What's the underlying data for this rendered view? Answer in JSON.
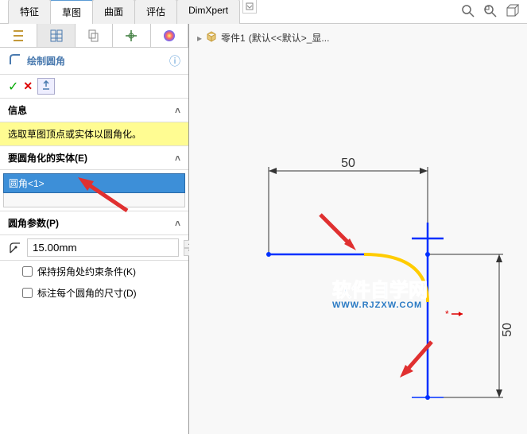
{
  "tabs": {
    "features": "特征",
    "sketch": "草图",
    "surface": "曲面",
    "evaluate": "评估",
    "dimxpert": "DimXpert"
  },
  "breadcrumb": {
    "part": "零件1",
    "config": "(默认<<默认>_显..."
  },
  "panel": {
    "title": "绘制圆角",
    "info_header": "信息",
    "info_text": "选取草图顶点或实体以圆角化。",
    "entities_header": "要圆角化的实体(E)",
    "entity_item": "圆角<1>",
    "params_header": "圆角参数(P)",
    "radius_value": "15.00mm",
    "keep_constraints": "保持拐角处约束条件(K)",
    "label_dims": "标注每个圆角的尺寸(D)"
  },
  "sketch_dims": {
    "horizontal": "50",
    "vertical": "50"
  },
  "watermark": {
    "cn": "软件自学网",
    "url": "WWW.RJZXW.COM"
  },
  "chart_data": {
    "type": "diagram",
    "description": "2D sketch with two perpendicular line segments meeting at a corner being filleted",
    "horizontal_line_length": 50,
    "vertical_line_length": 50,
    "fillet_radius": 15.0,
    "fillet_entity": "圆角<1>"
  }
}
